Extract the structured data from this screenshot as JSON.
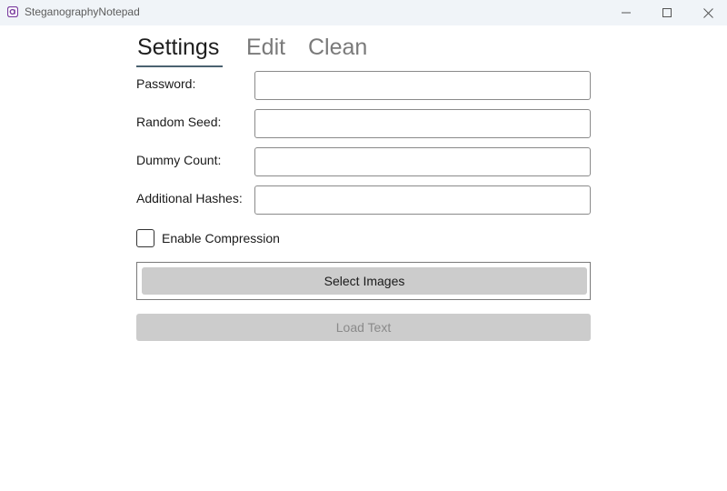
{
  "window": {
    "title": "SteganographyNotepad",
    "app_icon": "app-logo-icon",
    "controls": [
      "minimize-icon",
      "maximize-icon",
      "close-icon"
    ]
  },
  "tabs": [
    {
      "label": "Settings",
      "active": true
    },
    {
      "label": "Edit",
      "active": false
    },
    {
      "label": "Clean",
      "active": false
    }
  ],
  "fields": {
    "password": {
      "label": "Password:",
      "value": ""
    },
    "random_seed": {
      "label": "Random Seed:",
      "value": ""
    },
    "dummy_count": {
      "label": "Dummy Count:",
      "value": ""
    },
    "additional_hashes": {
      "label": "Additional Hashes:",
      "value": ""
    }
  },
  "compression": {
    "label": "Enable Compression",
    "checked": false
  },
  "buttons": {
    "select_images": "Select Images",
    "load_text": "Load Text"
  },
  "colors": {
    "titlebar_bg": "#f0f4f8",
    "tab_underline": "#4b6270",
    "button_bg": "#cccccc",
    "disabled_text": "#8a8a8a",
    "app_icon": "#7b3fa0"
  }
}
